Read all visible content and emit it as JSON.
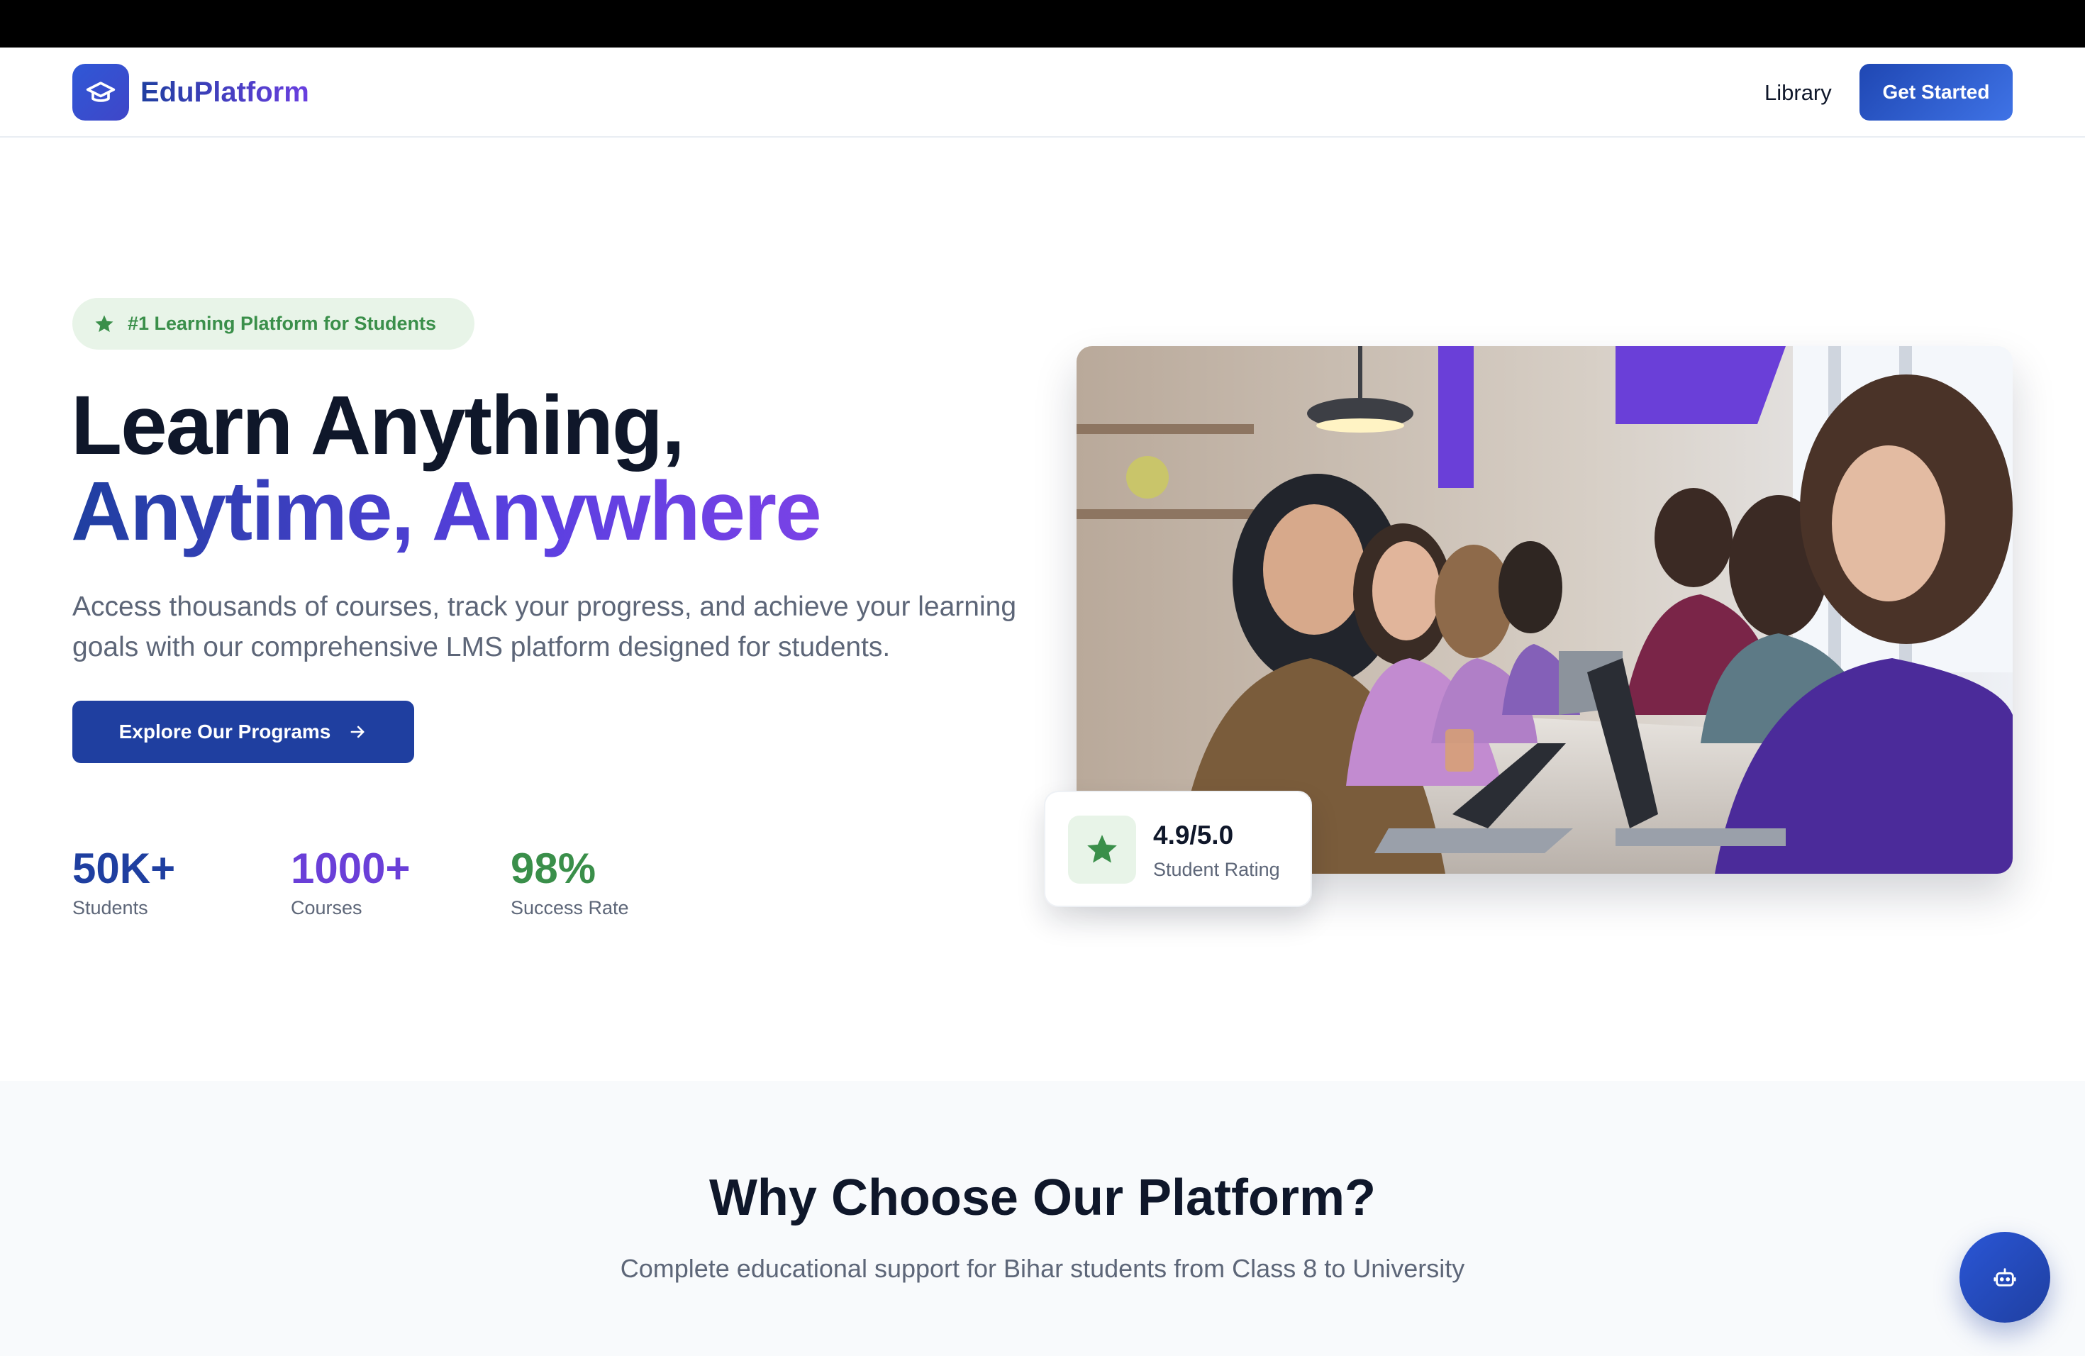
{
  "header": {
    "logo_icon": "graduation-cap-icon",
    "brand": "EduPlatform",
    "nav": {
      "library": "Library"
    },
    "cta": "Get Started"
  },
  "hero": {
    "badge": {
      "icon": "star-icon",
      "text": "#1 Learning Platform for Students"
    },
    "title_line1": "Learn Anything,",
    "title_line2": "Anytime, Anywhere",
    "description": "Access thousands of courses, track your progress, and achieve your learning goals with our comprehensive LMS platform designed for students.",
    "cta": {
      "label": "Explore Our Programs",
      "icon": "arrow-right-icon"
    },
    "stats": [
      {
        "value": "50K+",
        "label": "Students",
        "color": "#1f3fa0"
      },
      {
        "value": "1000+",
        "label": "Courses",
        "color": "#6a3fd8"
      },
      {
        "value": "98%",
        "label": "Success Rate",
        "color": "#3a8f4a"
      }
    ],
    "image": {
      "subject": "students working on laptops in a classroom"
    },
    "rating": {
      "icon": "star-icon",
      "value": "4.9/5.0",
      "label": "Student Rating"
    }
  },
  "why_section": {
    "title": "Why Choose Our Platform?",
    "subtitle": "Complete educational support for Bihar students from Class 8 to University"
  },
  "chat_widget": {
    "icon": "chatbot-icon"
  },
  "colors": {
    "primary": "#1f3fa0",
    "accent_purple": "#6a3fd8",
    "accent_green": "#3a8f4a",
    "text_dark": "#0f172a",
    "text_muted": "#5d6678"
  }
}
